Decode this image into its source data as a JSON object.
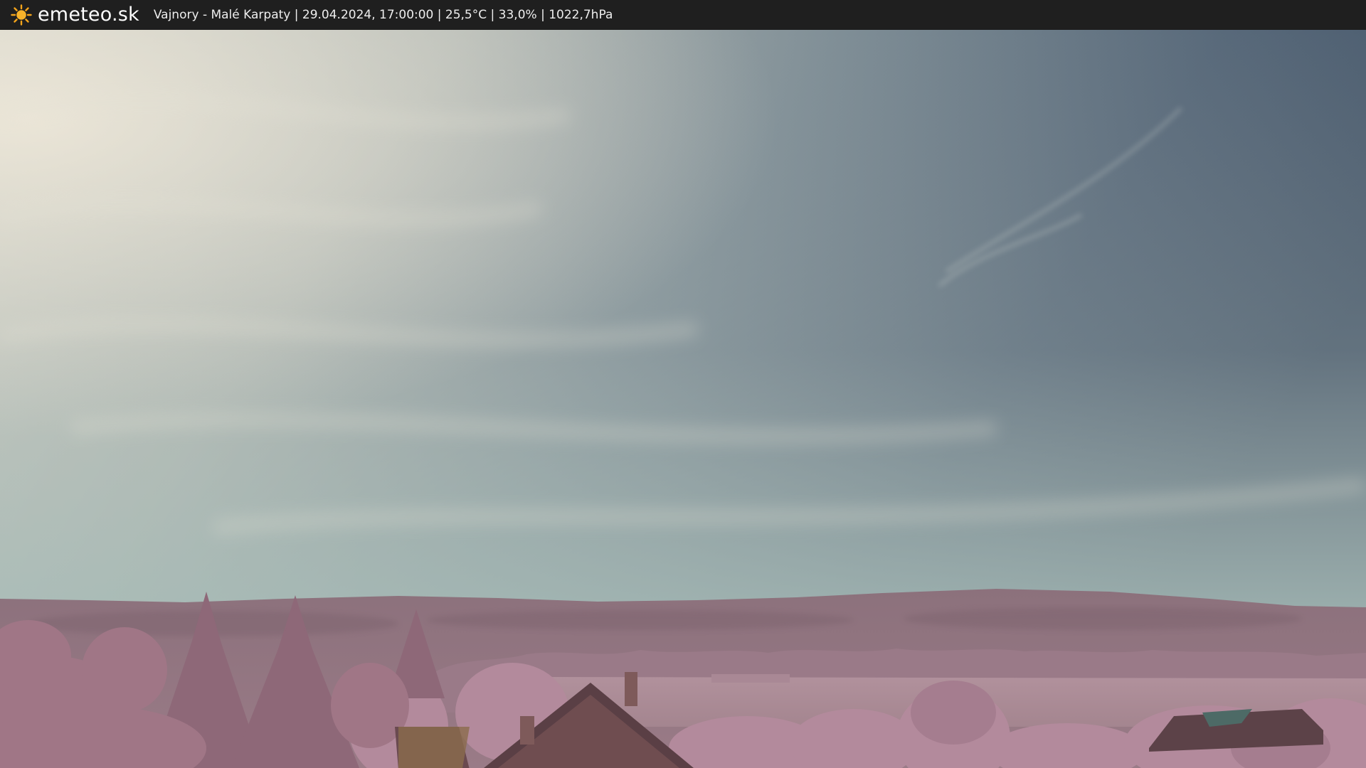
{
  "header": {
    "site_name": "emeteo.sk",
    "logo_icon": "sun-icon",
    "info_text": "Vajnory - Malé Karpaty | 29.04.2024, 17:00:00 | 25,5°C | 33,0% | 1022,7hPa"
  },
  "colors": {
    "bar_background": "#1f1f1f",
    "sun": "#f4a41a",
    "sky_light": "#c9cbc3",
    "sky_dark": "#4a5a67",
    "hills": "#8a6f7a",
    "vegetation": "#b48b9e"
  }
}
